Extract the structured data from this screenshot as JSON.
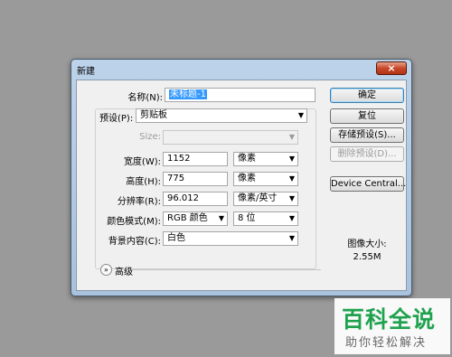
{
  "window": {
    "title": "新建",
    "close_glyph": "×"
  },
  "form": {
    "name": {
      "label": "名称(N):",
      "value": "未标题-1"
    },
    "preset": {
      "label": "预设(P):",
      "value": "剪贴板"
    },
    "size": {
      "label": "Size:",
      "value": ""
    },
    "width": {
      "label": "宽度(W):",
      "value": "1152",
      "unit": "像素"
    },
    "height": {
      "label": "高度(H):",
      "value": "775",
      "unit": "像素"
    },
    "resolution": {
      "label": "分辨率(R):",
      "value": "96.012",
      "unit": "像素/英寸"
    },
    "color_mode": {
      "label": "颜色模式(M):",
      "value": "RGB 颜色",
      "depth": "8 位"
    },
    "background": {
      "label": "背景内容(C):",
      "value": "白色"
    },
    "advanced": {
      "label": "高级"
    }
  },
  "buttons": {
    "ok": "确定",
    "reset": "复位",
    "save_preset": "存储预设(S)...",
    "delete_preset": "删除预设(D)...",
    "device_central": "Device Central..."
  },
  "image_size": {
    "label": "图像大小:",
    "value": "2.55M"
  },
  "watermark": {
    "title": "百科全说",
    "subtitle": "助你轻松解决"
  },
  "colors": {
    "background": "#9a9a9a",
    "selection": "#3399ff",
    "close_button": "#c8482a",
    "watermark_green": "#19a34a"
  }
}
